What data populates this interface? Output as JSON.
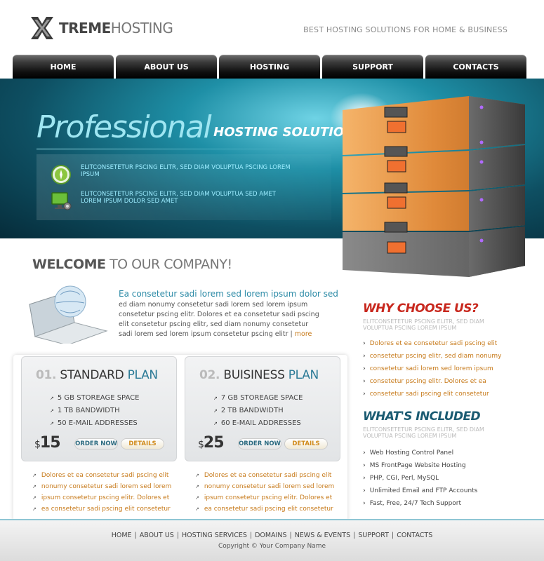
{
  "brand": {
    "name_bold": "TREME",
    "name_light": "HOSTING",
    "tagline": "BEST HOSTING SOLUTIONS FOR HOME & BUSINESS"
  },
  "nav": [
    "HOME",
    "ABOUT US",
    "HOSTING",
    "SUPPORT",
    "CONTACTS"
  ],
  "hero": {
    "title_main": "Professional",
    "title_sub": "HOSTING SOLUTIONS",
    "features": [
      {
        "icon": "compass-icon",
        "text": "ELITCONSETETUR PSCING ELITR, SED DIAM VOLUPTUA PSCING LOREM IPSUM"
      },
      {
        "icon": "monitor-gear-icon",
        "text": "ELITCONSETETUR PSCING ELITR, SED DIAM VOLUPTUA SED AMET LOREM IPSUM DOLOR SED AMET"
      }
    ]
  },
  "welcome": {
    "heading_bold": "WELCOME",
    "heading_rest": " TO OUR COMPANY!",
    "intro_title": "Ea consetetur sadi lorem sed lorem ipsum dolor sed",
    "intro_body": "ed diam nonumy consetetur sadi lorem sed lorem ipsum consetetur pscing elitr. Dolores et ea consetetur sadi pscing elit consetetur pscing elitr, sed diam nonumy consetetur sadi lorem sed lorem ipsum consetetur pscing elitr",
    "more_link": "more"
  },
  "plans": [
    {
      "num": "01.",
      "name": "STANDARD",
      "suffix": "PLAN",
      "features": [
        "5 GB STOREAGE SPACE",
        "1 TB BANDWIDTH",
        "50 E-MAIL ADDRESSES"
      ],
      "currency": "$",
      "price": "15",
      "order_label": "ORDER NOW",
      "details_label": "DETAILS",
      "links": [
        "Dolores et ea consetetur sadi pscing elit",
        "nonumy consetetur sadi lorem sed lorem",
        "ipsum consetetur pscing elitr. Dolores et",
        "ea consetetur sadi pscing elit consetetur"
      ]
    },
    {
      "num": "02.",
      "name": "BUISINESS",
      "suffix": "PLAN",
      "features": [
        "7 GB STOREAGE SPACE",
        "2 TB BANDWIDTH",
        "60 E-MAIL ADDRESSES"
      ],
      "currency": "$",
      "price": "25",
      "order_label": "ORDER NOW",
      "details_label": "DETAILS",
      "links": [
        "Dolores et ea consetetur sadi pscing elit",
        "nonumy consetetur sadi lorem sed lorem",
        "ipsum consetetur pscing elitr. Dolores et",
        "ea consetetur sadi pscing elit consetetur"
      ]
    }
  ],
  "why": {
    "title": "WHY CHOOSE US?",
    "subtitle": "ELITCONSETETUR PSCING ELITR, SED DIAM VOLUPTUA PSCING LOREM IPSUM",
    "items": [
      "Dolores et ea consetetur sadi pscing elit",
      "consetetur pscing elitr, sed diam nonumy",
      "consetetur sadi lorem sed lorem ipsum",
      "consetetur pscing elitr. Dolores et ea",
      "consetetur sadi pscing elit consetetur"
    ]
  },
  "included": {
    "title": "WHAT'S INCLUDED",
    "subtitle": "ELITCONSETETUR PSCING ELITR, SED DIAM VOLUPTUA PSCING LOREM IPSUM",
    "items": [
      "Web Hosting Control Panel",
      "MS FrontPage Website Hosting",
      "PHP, CGI, Perl, MySQL",
      "Unlimited Email and FTP Accounts",
      "Fast, Free, 24/7 Tech Support"
    ]
  },
  "footer": {
    "links": [
      "HOME",
      "ABOUT US",
      "HOSTING SERVICES",
      "DOMAINS",
      "NEWS & EVENTS",
      "SUPPORT",
      "CONTACTS"
    ],
    "copyright": "Copyright © Your Company Name"
  },
  "colors": {
    "accent_teal": "#2b8aa6",
    "accent_orange": "#c77a1a",
    "why_red": "#c8281e",
    "included_teal": "#1b5b72"
  }
}
